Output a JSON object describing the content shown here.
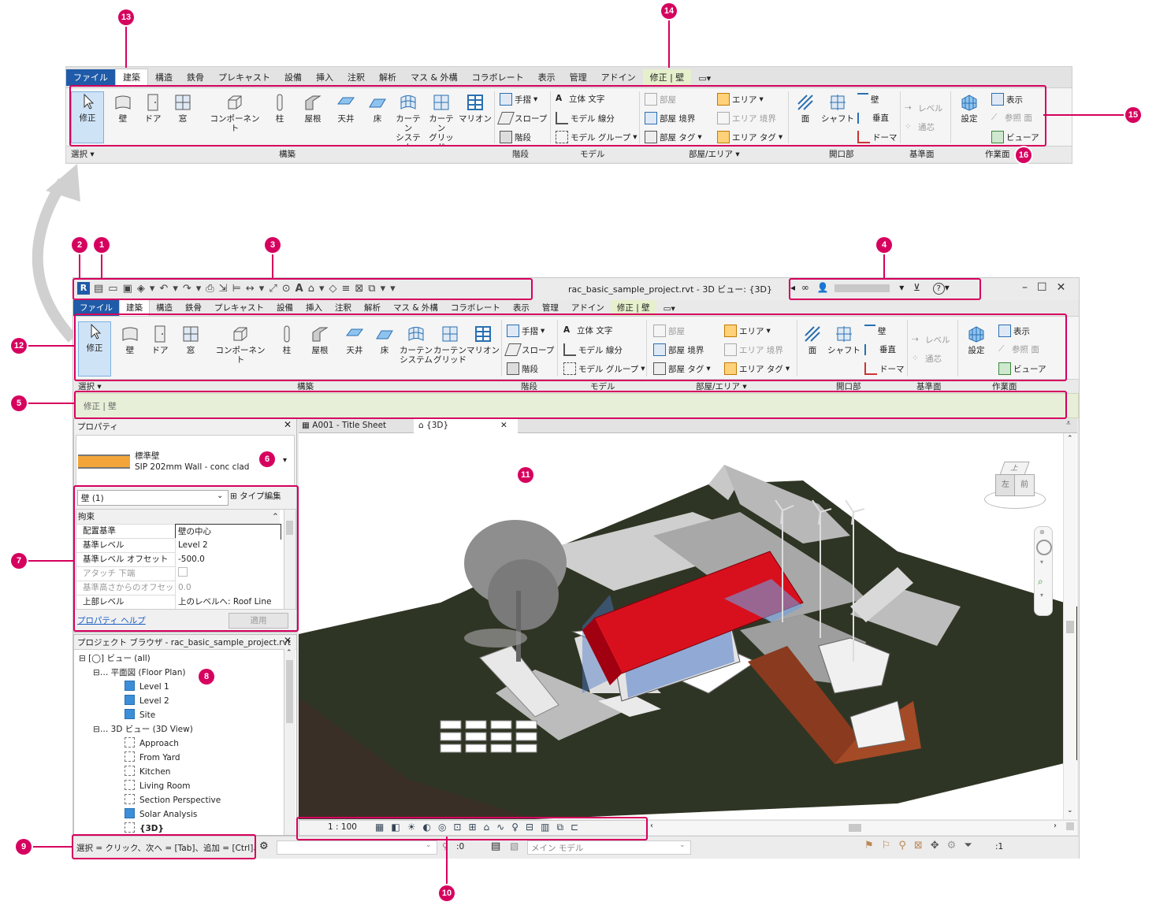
{
  "callouts": {
    "c1": "1",
    "c2": "2",
    "c3": "3",
    "c4": "4",
    "c5": "5",
    "c6": "6",
    "c7": "7",
    "c8": "8",
    "c9": "9",
    "c10": "10",
    "c11": "11",
    "c12": "12",
    "c13": "13",
    "c14": "14",
    "c15": "15",
    "c16": "16"
  },
  "tabs": [
    "ファイル",
    "建築",
    "構造",
    "鉄骨",
    "プレキャスト",
    "設備",
    "挿入",
    "注釈",
    "解析",
    "マス & 外構",
    "コラボレート",
    "表示",
    "管理",
    "アドイン",
    "修正 | 壁"
  ],
  "ribbon": {
    "select": "修正",
    "wall": "壁",
    "door": "ドア",
    "window": "窓",
    "component": "コンポーネント",
    "column": "柱",
    "roof": "屋根",
    "ceiling": "天井",
    "floor": "床",
    "curtain_system_1": "カーテン",
    "curtain_system_2": "システム",
    "curtain_grid_1": "カーテン",
    "curtain_grid_2": "グリッド",
    "mullion": "マリオン",
    "railing": "手摺",
    "ramp": "スロープ",
    "stair": "階段",
    "model_text": "立体 文字",
    "model_line": "モデル 線分",
    "model_group": "モデル グループ",
    "room": "部屋",
    "room_sep": "部屋 境界",
    "room_tag": "部屋 タグ",
    "area": "エリア",
    "area_boundary": "エリア 境界",
    "area_tag": "エリア タグ",
    "face": "面",
    "shaft": "シャフト",
    "op_wall": "壁",
    "vertical": "垂直",
    "dormer": "ドーマ",
    "level": "レベル",
    "grid": "通芯",
    "set": "設定",
    "show": "表示",
    "ref_plane": "参照 面",
    "viewer": "ビューア",
    "panels": {
      "select": "選択",
      "build": "構築",
      "circulation": "階段",
      "model": "モデル",
      "room_area": "部屋/エリア",
      "opening": "開口部",
      "datum": "基準面",
      "workplane": "作業面"
    }
  },
  "titlebar": {
    "title": "rac_basic_sample_project.rvt - 3D ビュー: {3D}"
  },
  "options_bar": "修正 | 壁",
  "properties": {
    "title": "プロパティ",
    "type_name": "標準壁",
    "type_sub": "SIP 202mm Wall - conc clad",
    "selector": "壁 (1)",
    "edit_type": "タイプ編集",
    "group": "拘束",
    "rows": [
      {
        "k": "配置基準",
        "v": "壁の中心"
      },
      {
        "k": "基準レベル",
        "v": "Level 2"
      },
      {
        "k": "基準レベル オフセット",
        "v": "-500.0"
      },
      {
        "k": "アタッチ 下端",
        "v": ""
      },
      {
        "k": "基準高さからのオフセット",
        "v": "0.0"
      },
      {
        "k": "上部レベル",
        "v": "上のレベルへ: Roof Line"
      }
    ],
    "help": "プロパティ ヘルプ",
    "apply": "適用"
  },
  "browser": {
    "title": "プロジェクト ブラウザ - rac_basic_sample_project.rvt",
    "views_all": "ビュー (all)",
    "floor_plan": "平面図 (Floor Plan)",
    "fp": [
      "Level 1",
      "Level 2",
      "Site"
    ],
    "view3d": "3D ビュー (3D View)",
    "v3": [
      "Approach",
      "From Yard",
      "Kitchen",
      "Living Room",
      "Section Perspective",
      "Solar Analysis",
      "{3D}"
    ]
  },
  "view_tabs": [
    "A001 - Title Sheet",
    "{3D}"
  ],
  "view_bar": {
    "scale": "1 : 100"
  },
  "status": {
    "text": "選択 = クリック、次へ = [Tab]、追加 = [Ctrl]、選",
    "count": ":0",
    "model": "メイン モデル",
    "filter": ":1"
  },
  "viewcube": {
    "top": "上",
    "front": "前",
    "left": "左"
  },
  "colors": {
    "accent": "#d6005e",
    "file_tab": "#1f5ba8",
    "contextual": "#e6f0cc",
    "terrain": "#2f3524",
    "roof": "#d8101e"
  }
}
